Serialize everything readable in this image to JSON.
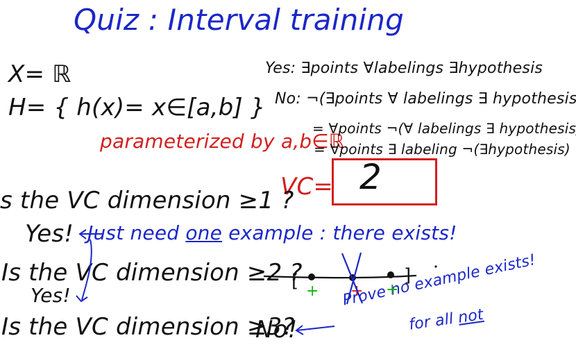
{
  "title": "Quiz : Interval training",
  "left": {
    "x_def": "X= ℝ",
    "h_def": "H= { h(x)= x∈[a,b] }",
    "param": "parameterized by a,b∈ℝ"
  },
  "right": {
    "yes": "Yes: ∃points ∀labelings ∃hypothesis",
    "no": "No: ¬(∃points ∀ labelings ∃ hypothesis)",
    "eq1": "= ∀points ¬(∀ labelings ∃ hypothesis)",
    "eq2": "= ∀points ∃ labeling ¬(∃hypothesis)",
    "vc_label": "VC=",
    "vc_value": "2"
  },
  "questions": {
    "q1": "s the VC dimension ≥1 ?",
    "a1": "Yes!",
    "a1_note_prefix": "Just need ",
    "a1_note_under": "one",
    "a1_note_suffix": " example : there exists!",
    "q2": "Is the VC dimension ≥2 ?",
    "a2": "Yes!",
    "q3": "Is the VC dimension ≥3?",
    "a3": "No!",
    "a3_note": "Prove no example exists!",
    "a3_note2_prefix": "for all ",
    "a3_note2_under": "not"
  },
  "diagram": {
    "plus_left": "+",
    "minus_mid": "+",
    "plus_right": "+",
    "bracket_left": "[",
    "bracket_right": "]"
  },
  "colors": {
    "blue": "#1b27c7",
    "black": "#111111",
    "red": "#d31f1f",
    "green": "#18b018"
  }
}
